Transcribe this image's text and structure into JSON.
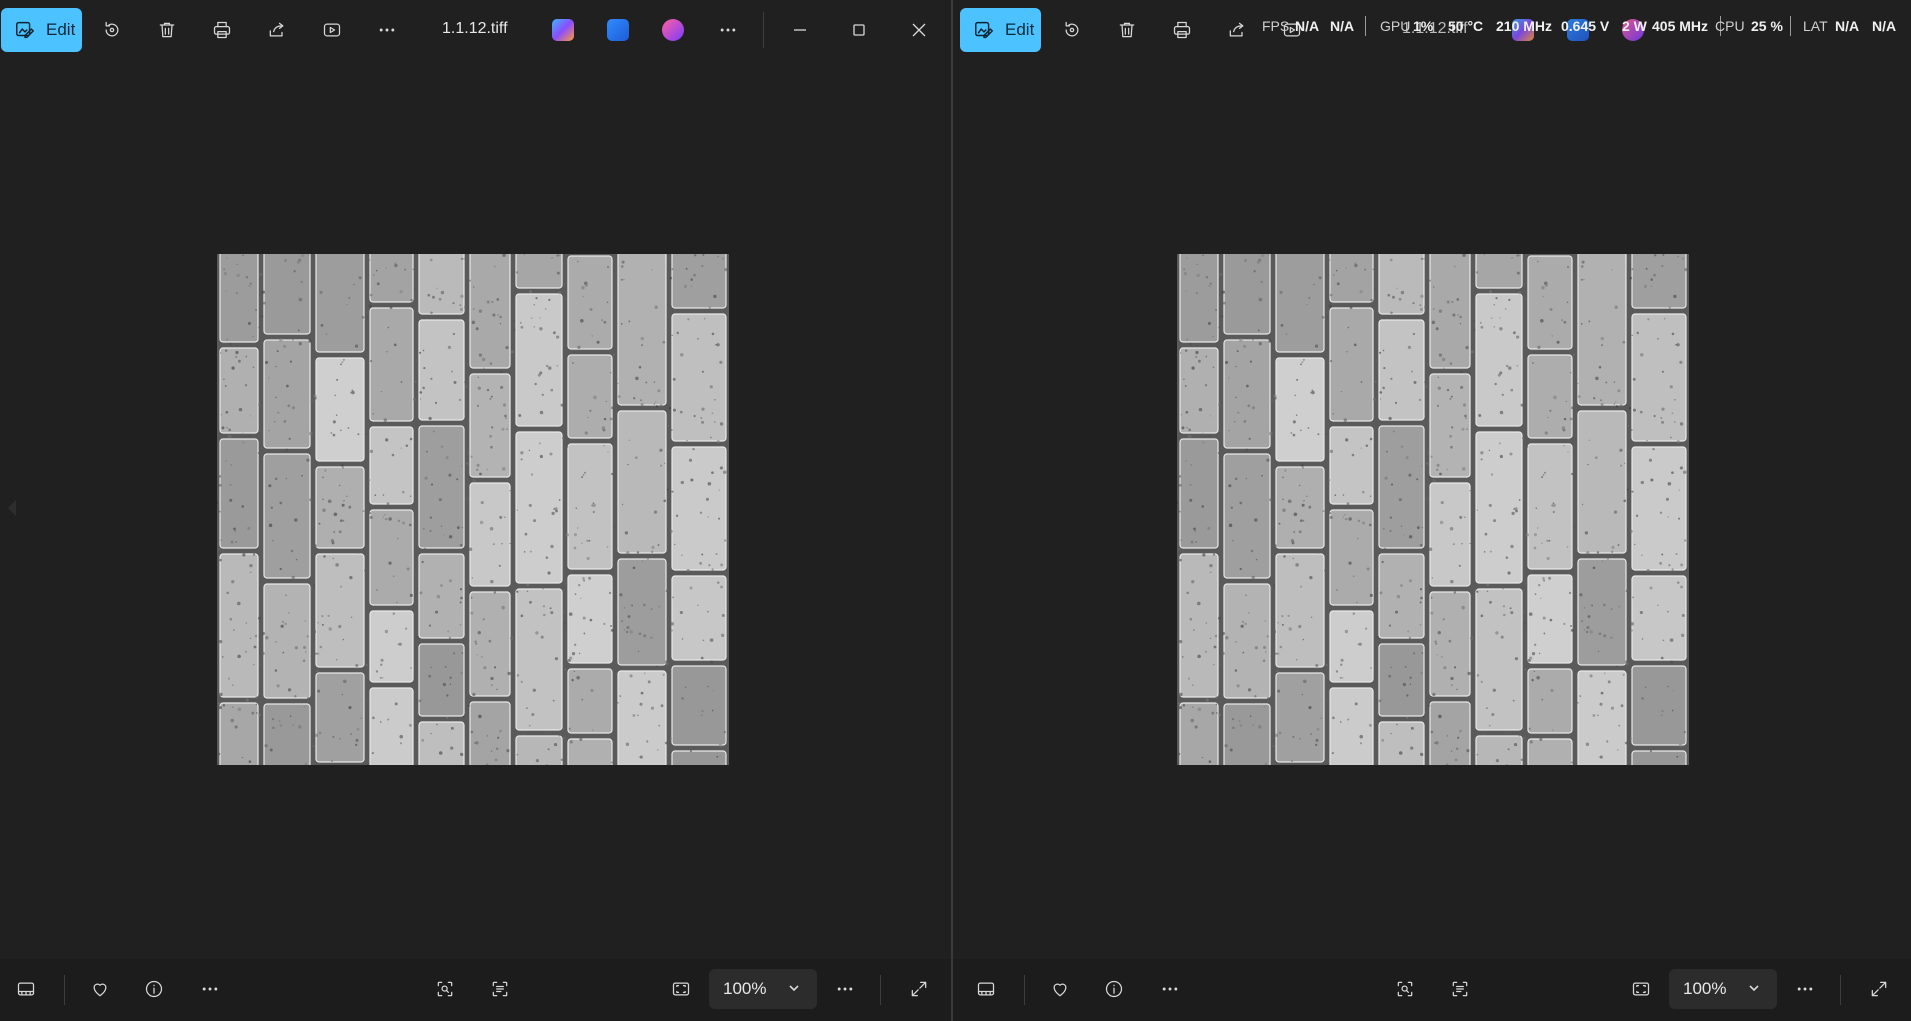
{
  "left_window": {
    "edit_label": "Edit",
    "filename": "1.1.12.tiff",
    "zoom": "100%"
  },
  "right_window": {
    "edit_label": "Edit",
    "filename": "1.1.12.tiff",
    "zoom": "100%"
  },
  "perf_overlay": {
    "fps_label": "FPS",
    "fps_value": "N/A",
    "fps_value2": "N/A",
    "gpu_label": "GPU",
    "gpu_usage": "1%",
    "gpu_temp": "50 °C",
    "gpu_clock": "210 MHz",
    "gpu_voltage": "0.645 V",
    "gpu_power": "2 W",
    "gpu_mem_clock": "405 MHz",
    "cpu_label": "CPU",
    "cpu_usage": "25 %",
    "lat_label": "LAT",
    "lat_value": "N/A",
    "lat_value2": "N/A"
  },
  "colors": {
    "accent": "#4cc2ff",
    "background": "#202020",
    "bottom_bar": "#1c1c1c"
  },
  "icons": [
    "edit-image-icon",
    "rotate-icon",
    "delete-icon",
    "print-icon",
    "share-icon",
    "slideshow-icon",
    "more-icon",
    "copilot-icon",
    "designer-icon",
    "clipchamp-icon",
    "minimize-icon",
    "maximize-icon",
    "close-icon",
    "filmstrip-icon",
    "favorite-icon",
    "info-icon",
    "visual-search-icon",
    "text-scan-icon",
    "fit-icon",
    "chevron-down-icon",
    "fullscreen-icon"
  ]
}
